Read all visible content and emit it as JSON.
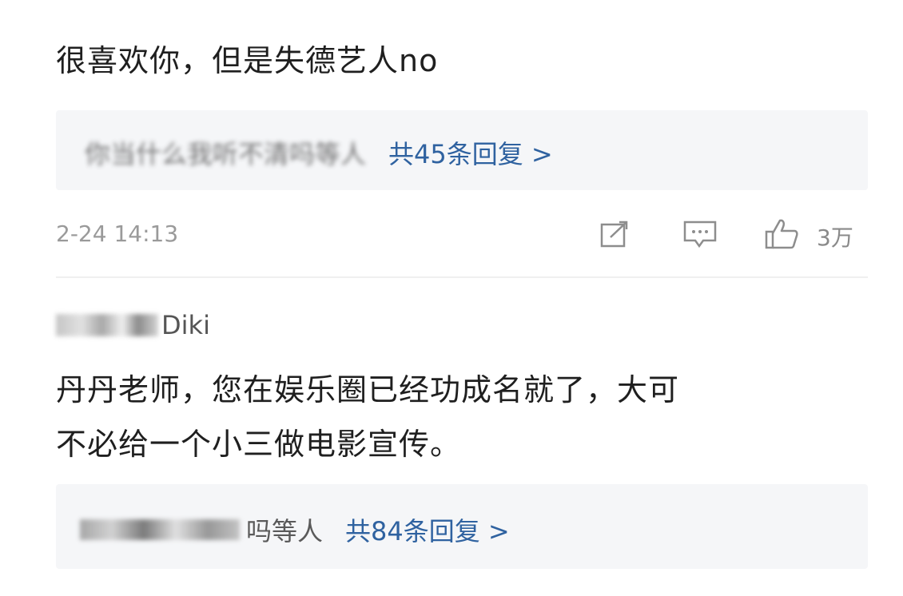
{
  "comment1": {
    "text": "很喜欢你，但是失德艺人no",
    "reply_preview": {
      "names": "你当什么我听不清吗等人",
      "count": "共45条回复 >"
    },
    "timestamp": "2-24 14:13",
    "like_count": "3万"
  },
  "comment2": {
    "username": "Diki",
    "text_line1": "丹丹老师，您在娱乐圈已经功成名就了，大可",
    "text_line2": "不必给一个小三做电影宣传。",
    "reply_preview": {
      "names": "吗等人",
      "count": "共84条回复 >"
    }
  },
  "icons": [
    "share-icon",
    "comment-icon",
    "like-icon"
  ],
  "colors": {
    "link": "#2f62a0",
    "reply_bg": "#f5f6f8",
    "meta": "#9a9a9a"
  }
}
